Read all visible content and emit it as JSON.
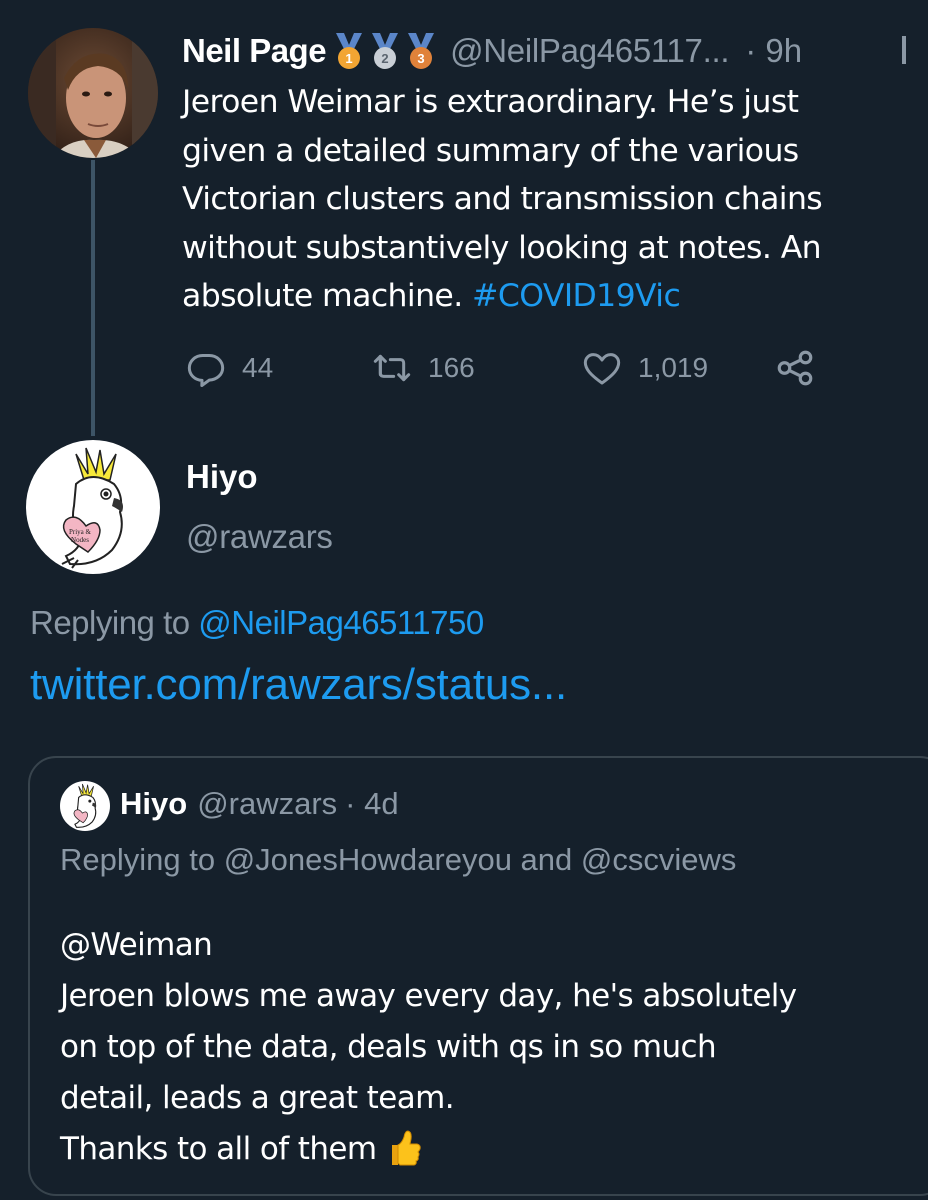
{
  "thread": {
    "tweet": {
      "author_name": "Neil Page",
      "medals": [
        "1",
        "2",
        "3"
      ],
      "handle": "@NeilPag465117...",
      "time": "· 9h",
      "lines": [
        "Jeroen Weimar is extraordinary. He’s just",
        "given a detailed summary of the various",
        "Victorian clusters and transmission chains",
        "without substantively looking at notes. An"
      ],
      "last_line_text": "absolute machine.",
      "hashtag": "#COVID19Vic",
      "actions": {
        "replies": "44",
        "retweets": "166",
        "likes": "1,019"
      }
    }
  },
  "reply": {
    "author_name": "Hiyo",
    "handle": "@rawzars",
    "avatar_text": "Priya & Nodes",
    "replying_prefix": "Replying to",
    "replying_to": "@NeilPag46511750",
    "link": "twitter.com/rawzars/status..."
  },
  "quote": {
    "author_name": "Hiyo",
    "handle": "@rawzars",
    "time": "· 4d",
    "replying": "Replying to @JonesHowdareyou and @cscviews",
    "lines": [
      "@Weiman",
      "Jeroen blows me away every day, he's absolutely",
      "on top of the data, deals with qs in so much",
      "detail, leads a great team."
    ],
    "last_line": "Thanks to all of them",
    "emoji": "👍"
  },
  "colors": {
    "background": "#15202b",
    "text": "#ffffff",
    "secondary": "#8b98a5",
    "accent": "#1d9bf0",
    "border": "#38444d"
  },
  "icons": {
    "reply": "reply-icon",
    "retweet": "retweet-icon",
    "like": "heart-icon",
    "share": "share-icon",
    "more": "more-icon"
  }
}
